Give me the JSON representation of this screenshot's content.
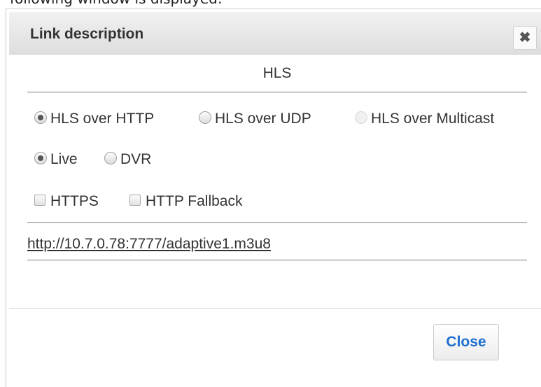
{
  "background": {
    "fragment_text": "following window is displayed:"
  },
  "dialog": {
    "title": "Link description",
    "close_icon": "✖",
    "section_title": "HLS",
    "protocol_options": [
      {
        "label": "HLS over HTTP",
        "checked": true,
        "disabled": false
      },
      {
        "label": "HLS over UDP",
        "checked": false,
        "disabled": false
      },
      {
        "label": "HLS over Multicast",
        "checked": false,
        "disabled": true
      }
    ],
    "mode_options": [
      {
        "label": "Live",
        "checked": true
      },
      {
        "label": "DVR",
        "checked": false
      }
    ],
    "checkboxes": [
      {
        "label": "HTTPS",
        "checked": false
      },
      {
        "label": "HTTP Fallback",
        "checked": false
      }
    ],
    "url": "http://10.7.0.78:7777/adaptive1.m3u8",
    "close_button_label": "Close"
  },
  "colors": {
    "header_bg": "#e6e6e6",
    "close_button_text": "#1e6fd0",
    "text": "#333333"
  }
}
